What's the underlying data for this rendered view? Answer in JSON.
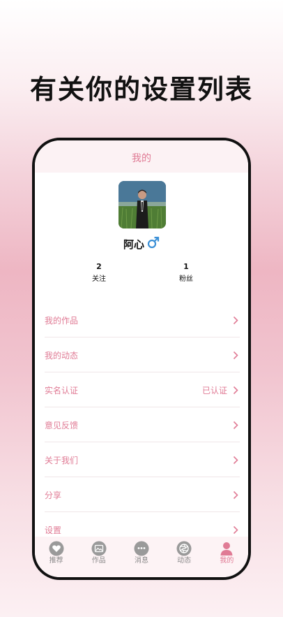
{
  "headline": "有关你的设置列表",
  "nav": {
    "title": "我的"
  },
  "profile": {
    "name": "阿心",
    "gender_icon": "male-icon"
  },
  "stats": [
    {
      "value": "2",
      "label": "关注"
    },
    {
      "value": "1",
      "label": "粉丝"
    }
  ],
  "menu": [
    {
      "label": "我的作品",
      "status": ""
    },
    {
      "label": "我的动态",
      "status": ""
    },
    {
      "label": "实名认证",
      "status": "已认证"
    },
    {
      "label": "意见反馈",
      "status": ""
    },
    {
      "label": "关于我们",
      "status": ""
    },
    {
      "label": "分享",
      "status": ""
    },
    {
      "label": "设置",
      "status": ""
    }
  ],
  "tabs": [
    {
      "label": "推荐",
      "icon": "heart-icon",
      "active": false
    },
    {
      "label": "作品",
      "icon": "image-icon",
      "active": false
    },
    {
      "label": "消息",
      "icon": "chat-icon",
      "active": false
    },
    {
      "label": "动态",
      "icon": "aperture-icon",
      "active": false
    },
    {
      "label": "我的",
      "icon": "person-icon",
      "active": true
    }
  ],
  "colors": {
    "accent": "#e07b95",
    "tab_inactive": "#8a8a8a",
    "gender_blue": "#3a8fd6",
    "frame": "#111111"
  }
}
